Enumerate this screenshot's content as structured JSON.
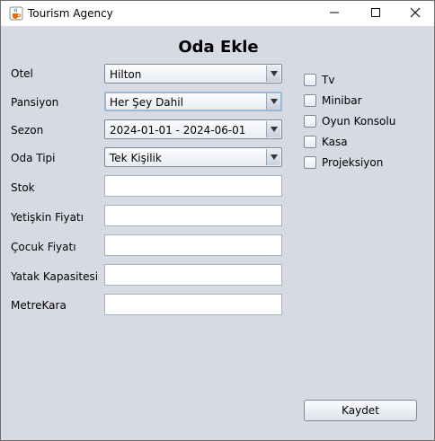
{
  "window": {
    "title": "Tourism Agency",
    "icon": "java-cup-icon"
  },
  "form": {
    "heading": "Oda Ekle",
    "fields": [
      {
        "label": "Otel",
        "type": "combo",
        "value": "Hilton"
      },
      {
        "label": "Pansiyon",
        "type": "combo",
        "value": "Her Şey Dahil"
      },
      {
        "label": "Sezon",
        "type": "combo",
        "value": "2024-01-01 - 2024-06-01"
      },
      {
        "label": "Oda Tipi",
        "type": "combo",
        "value": "Tek Kişilik"
      },
      {
        "label": "Stok",
        "type": "text",
        "value": ""
      },
      {
        "label": "Yetişkin Fiyatı",
        "type": "text",
        "value": ""
      },
      {
        "label": "Çocuk Fiyatı",
        "type": "text",
        "value": ""
      },
      {
        "label": "Yatak Kapasitesi",
        "type": "text",
        "value": ""
      },
      {
        "label": "MetreKara",
        "type": "text",
        "value": ""
      }
    ],
    "features": [
      {
        "label": "Tv",
        "checked": false
      },
      {
        "label": "Minibar",
        "checked": false
      },
      {
        "label": "Oyun Konsolu",
        "checked": false
      },
      {
        "label": "Kasa",
        "checked": false
      },
      {
        "label": "Projeksiyon",
        "checked": false
      }
    ],
    "save_label": "Kaydet"
  },
  "colors": {
    "background": "#d7dae3",
    "field_border": "#a6b2c0",
    "focus_border": "#9cb7d6"
  }
}
